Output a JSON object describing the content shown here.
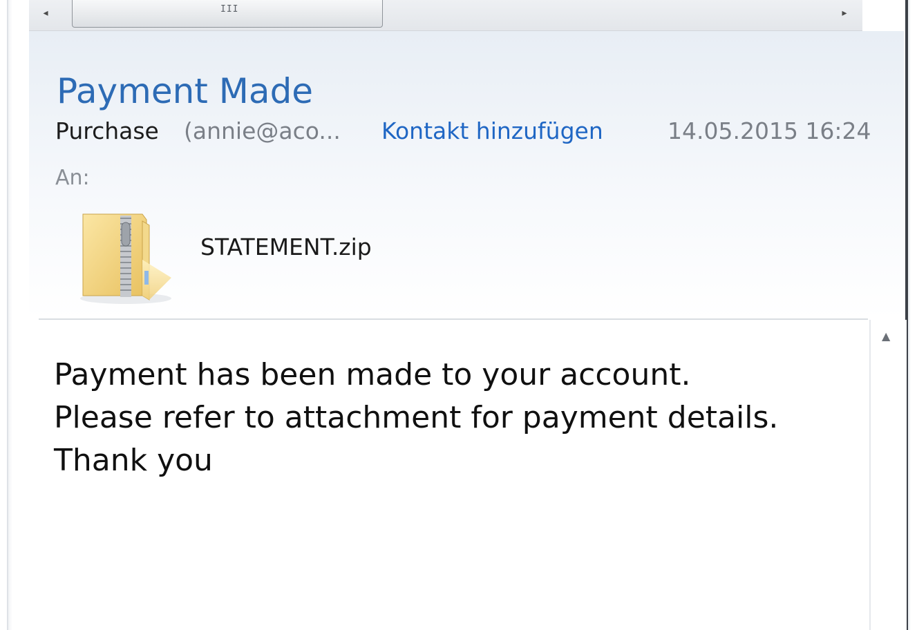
{
  "scrollbar": {
    "left_arrow": "◂",
    "right_arrow": "▸",
    "grip": "III",
    "up_arrow": "▲"
  },
  "email": {
    "subject": "Payment Made",
    "sender_name": "Purchase",
    "sender_email": "(annie@aco...",
    "add_contact_label": "Kontakt hinzufügen",
    "date": "14.05.2015 16:24",
    "to_label": "An:"
  },
  "attachment": {
    "icon": "zip-folder-icon",
    "filename": "STATEMENT.zip"
  },
  "body": {
    "lines": [
      "Payment has been made to your account.",
      "Please refer to attachment for payment details.",
      "Thank you"
    ]
  },
  "colors": {
    "subject": "#2d6bb5",
    "link": "#1f66c4",
    "muted": "#7a7f87"
  }
}
